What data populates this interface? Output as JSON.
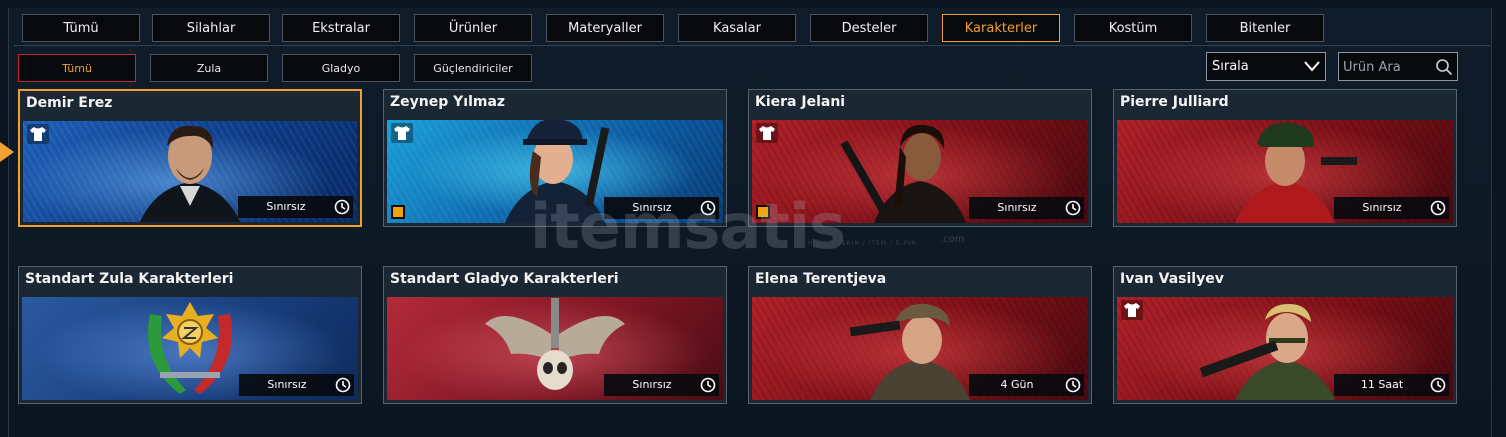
{
  "tabs": [
    {
      "label": "Tümü",
      "active": false
    },
    {
      "label": "Silahlar",
      "active": false
    },
    {
      "label": "Ekstralar",
      "active": false
    },
    {
      "label": "Ürünler",
      "active": false
    },
    {
      "label": "Materyaller",
      "active": false
    },
    {
      "label": "Kasalar",
      "active": false
    },
    {
      "label": "Desteler",
      "active": false
    },
    {
      "label": "Karakterler",
      "active": true
    },
    {
      "label": "Kostüm",
      "active": false
    },
    {
      "label": "Bitenler",
      "active": false
    }
  ],
  "subtabs": [
    {
      "label": "Tümü",
      "active": true
    },
    {
      "label": "Zula",
      "active": false
    },
    {
      "label": "Gladyo",
      "active": false
    },
    {
      "label": "Güçlendiriciler",
      "active": false
    }
  ],
  "sort": {
    "label": "Sırala"
  },
  "search": {
    "placeholder": "Ürün Ara"
  },
  "watermark": {
    "logo": "itemsatis",
    "sub": "HESAP / SKIN / ITEM / E-PIN",
    "com": ".com"
  },
  "cards": [
    {
      "name": "Demir Erez",
      "duration": "Sınırsız",
      "theme": "blue",
      "shirt": true,
      "badge": false,
      "selected": true
    },
    {
      "name": "Zeynep Yılmaz",
      "duration": "Sınırsız",
      "theme": "cyan",
      "shirt": true,
      "badge": true,
      "selected": false
    },
    {
      "name": "Kiera Jelani",
      "duration": "Sınırsız",
      "theme": "red",
      "shirt": true,
      "badge": true,
      "selected": false
    },
    {
      "name": "Pierre Julliard",
      "duration": "Sınırsız",
      "theme": "red",
      "shirt": false,
      "badge": false,
      "selected": false
    },
    {
      "name": "Standart Zula Karakterleri",
      "duration": "Sınırsız",
      "theme": "zula",
      "shirt": false,
      "badge": false,
      "selected": false
    },
    {
      "name": "Standart Gladyo Karakterleri",
      "duration": "Sınırsız",
      "theme": "gladyo",
      "shirt": false,
      "badge": false,
      "selected": false
    },
    {
      "name": "Elena Terentjeva",
      "duration": "4 Gün",
      "theme": "red",
      "shirt": false,
      "badge": false,
      "selected": false
    },
    {
      "name": "Ivan Vasilyev",
      "duration": "11 Saat",
      "theme": "red",
      "shirt": true,
      "badge": false,
      "selected": false
    }
  ],
  "colors": {
    "accent": "#f0a030",
    "active_subtab_border": "#c4252b",
    "badge": "#f2a20c",
    "background": "#0b1420"
  },
  "icons": {
    "shirt": "tshirt-icon",
    "clock": "clock-icon",
    "search": "search-icon",
    "chevron": "chevron-down-icon"
  }
}
